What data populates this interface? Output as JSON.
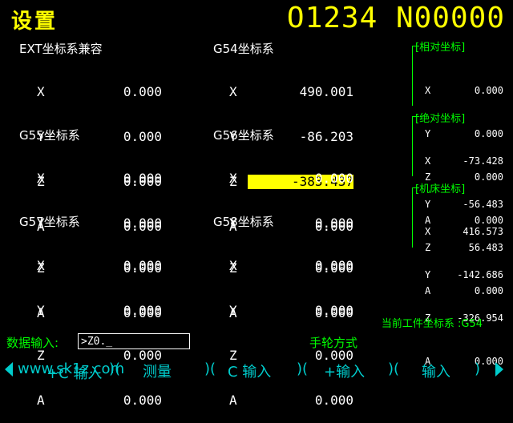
{
  "header": {
    "title": "设置",
    "program": "O1234 N00000"
  },
  "groups": [
    {
      "title": "EXT坐标系兼容",
      "rows": [
        [
          "X",
          "0.000"
        ],
        [
          "Y",
          "0.000"
        ],
        [
          "Z",
          "0.000"
        ],
        [
          "A",
          "0.000"
        ]
      ]
    },
    {
      "title": "G54坐标系",
      "rows": [
        [
          "X",
          "490.001"
        ],
        [
          "Y",
          "-86.203"
        ],
        [
          "Z",
          "-383.437"
        ],
        [
          "A",
          "0.000"
        ]
      ]
    },
    {
      "title": "G55坐标系",
      "rows": [
        [
          "X",
          "0.000"
        ],
        [
          "Y",
          "0.000"
        ],
        [
          "Z",
          "0.000"
        ],
        [
          "A",
          "0.000"
        ]
      ]
    },
    {
      "title": "G56坐标系",
      "rows": [
        [
          "X",
          "0.000"
        ],
        [
          "Y",
          "0.000"
        ],
        [
          "Z",
          "0.000"
        ],
        [
          "A",
          "0.000"
        ]
      ]
    },
    {
      "title": "G57坐标系",
      "rows": [
        [
          "X",
          "0.000"
        ],
        [
          "Y",
          "0.000"
        ],
        [
          "Z",
          "0.000"
        ],
        [
          "A",
          "0.000"
        ]
      ]
    },
    {
      "title": "G58坐标系",
      "rows": [
        [
          "X",
          "0.000"
        ],
        [
          "Y",
          "0.000"
        ],
        [
          "Z",
          "0.000"
        ],
        [
          "A",
          "0.000"
        ]
      ]
    }
  ],
  "highlight": {
    "group": "G54坐标系",
    "axis": "Z",
    "color": "#ffff00"
  },
  "right_panel": [
    {
      "title": "[相对坐标]",
      "rows": [
        [
          "X",
          "0.000"
        ],
        [
          "Y",
          "0.000"
        ],
        [
          "Z",
          "0.000"
        ],
        [
          "A",
          "0.000"
        ]
      ]
    },
    {
      "title": "[绝对坐标]",
      "rows": [
        [
          "X",
          "-73.428"
        ],
        [
          "Y",
          "-56.483"
        ],
        [
          "Z",
          "56.483"
        ],
        [
          "A",
          "0.000"
        ]
      ]
    },
    {
      "title": "[机床坐标]",
      "rows": [
        [
          "X",
          "416.573"
        ],
        [
          "Y",
          "-142.686"
        ],
        [
          "Z",
          "-326.954"
        ],
        [
          "A",
          "0.000"
        ]
      ]
    }
  ],
  "status": {
    "current_wcs": "当前工件坐标系 :G54",
    "mode": "手轮方式"
  },
  "input": {
    "label": "数据输入:",
    "value": ">Z0._"
  },
  "softkeys": {
    "k1": "+C 输入",
    "k2": "测量",
    "k3": "C 输入",
    "k4": "+输入",
    "k5": "输入",
    "watermark": "www.sk1z.com"
  },
  "colors": {
    "title": "#ffff00",
    "accent": "#00ff00",
    "softkey": "#00cccc"
  }
}
